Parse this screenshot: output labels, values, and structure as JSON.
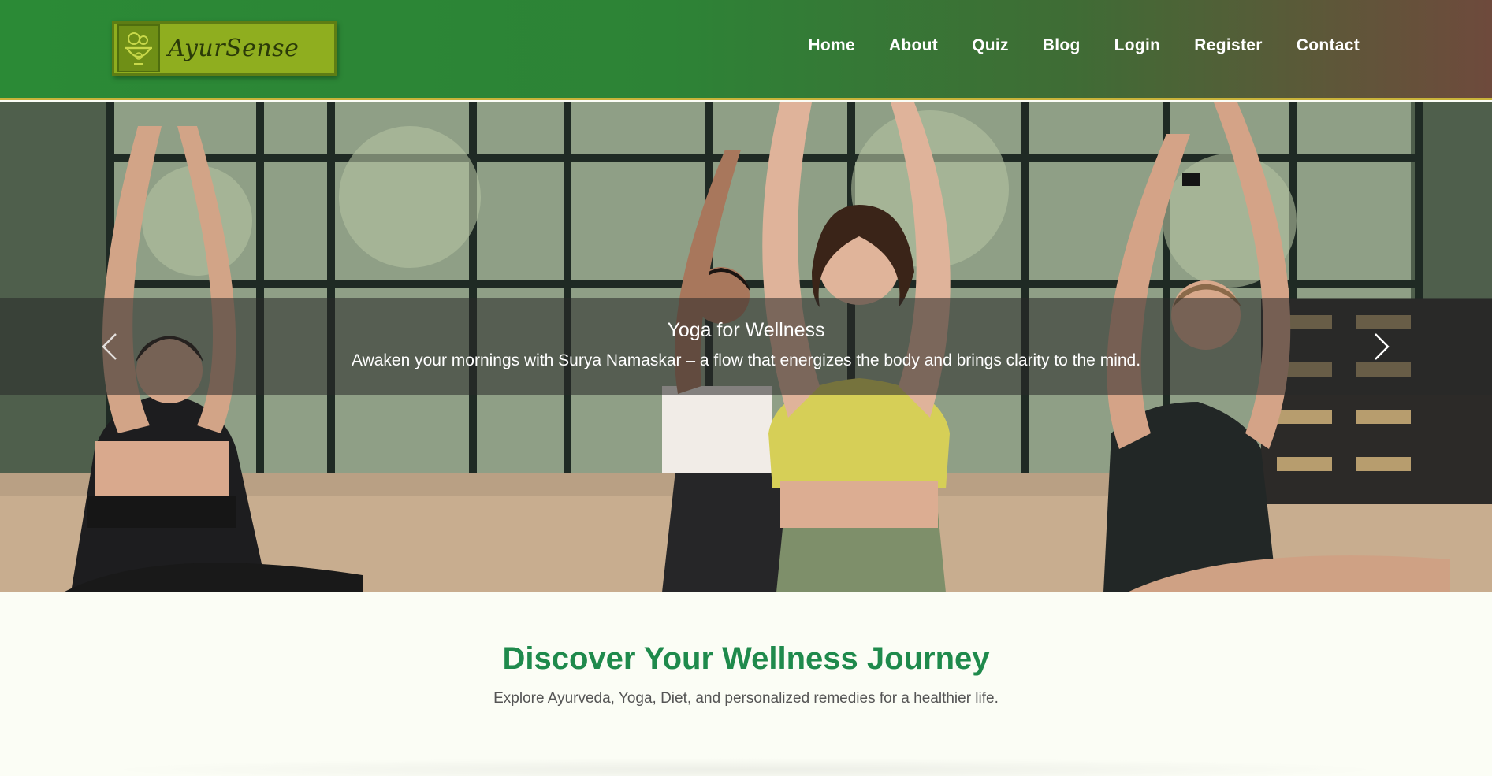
{
  "brand": {
    "name": "AyurSense"
  },
  "nav": {
    "items": [
      {
        "label": "Home"
      },
      {
        "label": "About"
      },
      {
        "label": "Quiz"
      },
      {
        "label": "Blog"
      },
      {
        "label": "Login"
      },
      {
        "label": "Register"
      },
      {
        "label": "Contact"
      }
    ]
  },
  "hero": {
    "caption_title": "Yoga for Wellness",
    "caption_text": "Awaken your mornings with Surya Namaskar – a flow that energizes the body and brings clarity to the mind.",
    "prev_icon": "chevron-left-icon",
    "next_icon": "chevron-right-icon"
  },
  "intro": {
    "title": "Discover Your Wellness Journey",
    "subtitle": "Explore Ayurveda, Yoga, Diet, and personalized remedies for a healthier life."
  },
  "colors": {
    "header_green": "#2b8a36",
    "header_brown": "#6e4a3c",
    "accent_gold": "#c9b33a",
    "logo_bg": "#8fae1f",
    "heading_green": "#1f8a4c",
    "page_bg": "#fbfdf5"
  }
}
